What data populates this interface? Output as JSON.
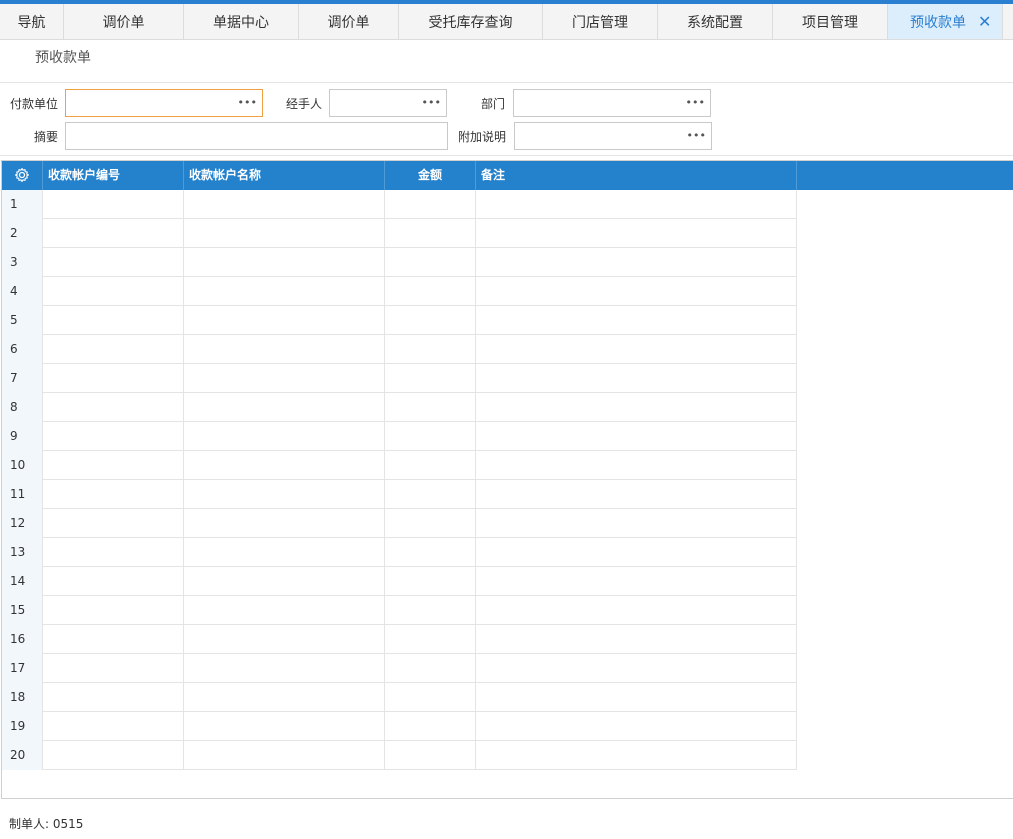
{
  "tabs": [
    {
      "label": "导航"
    },
    {
      "label": "调价单"
    },
    {
      "label": "单据中心"
    },
    {
      "label": "调价单"
    },
    {
      "label": "受托库存查询"
    },
    {
      "label": "门店管理"
    },
    {
      "label": "系统配置"
    },
    {
      "label": "项目管理"
    },
    {
      "label": "预收款单",
      "active": true
    }
  ],
  "page_title": "预收款单",
  "form": {
    "payer_label": "付款单位",
    "payer_value": "",
    "handler_label": "经手人",
    "handler_value": "",
    "dept_label": "部门",
    "dept_value": "",
    "summary_label": "摘要",
    "summary_value": "",
    "note_label": "附加说明",
    "note_value": "",
    "lookup_glyph": "•••"
  },
  "grid": {
    "settings_icon": "gear-icon",
    "columns": [
      "收款帐户编号",
      "收款帐户名称",
      "金额",
      "备注"
    ],
    "row_numbers": [
      "1",
      "2",
      "3",
      "4",
      "5",
      "6",
      "7",
      "8",
      "9",
      "10",
      "11",
      "12",
      "13",
      "14",
      "15",
      "16",
      "17",
      "18",
      "19",
      "20"
    ]
  },
  "footer": {
    "creator_label": "制单人:",
    "creator_value": "0515"
  },
  "colors": {
    "accent": "#2b7fd0",
    "grid_header": "#2481cc",
    "focus_border": "#f0a040"
  }
}
